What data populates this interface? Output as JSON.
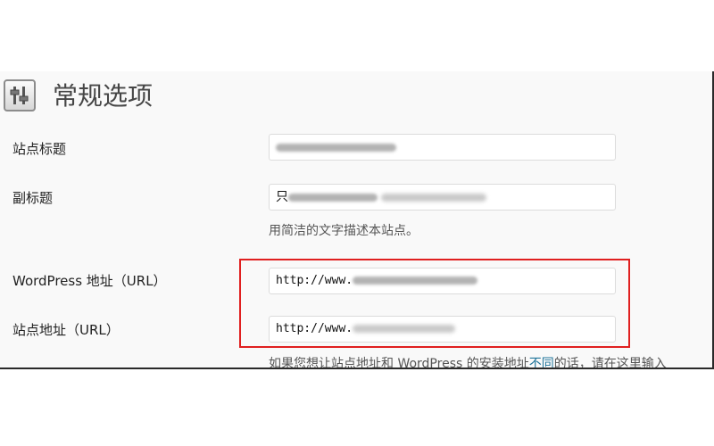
{
  "page": {
    "title": "常规选项",
    "icon": "settings-sliders-icon"
  },
  "fields": {
    "site_title": {
      "label": "站点标题",
      "value": ""
    },
    "tagline": {
      "label": "副标题",
      "value": "只",
      "hint": "用简洁的文字描述本站点。"
    },
    "wp_address": {
      "label": "WordPress 地址（URL）",
      "value": "http://www."
    },
    "site_address": {
      "label": "站点地址（URL）",
      "value": "http://www.",
      "hint_before": "如果您想让站点地址和 WordPress 的安装地址",
      "hint_link": "不同",
      "hint_after": "的话，请在这里输入"
    }
  },
  "colors": {
    "highlight_border": "#e02020",
    "link": "#21759b"
  }
}
